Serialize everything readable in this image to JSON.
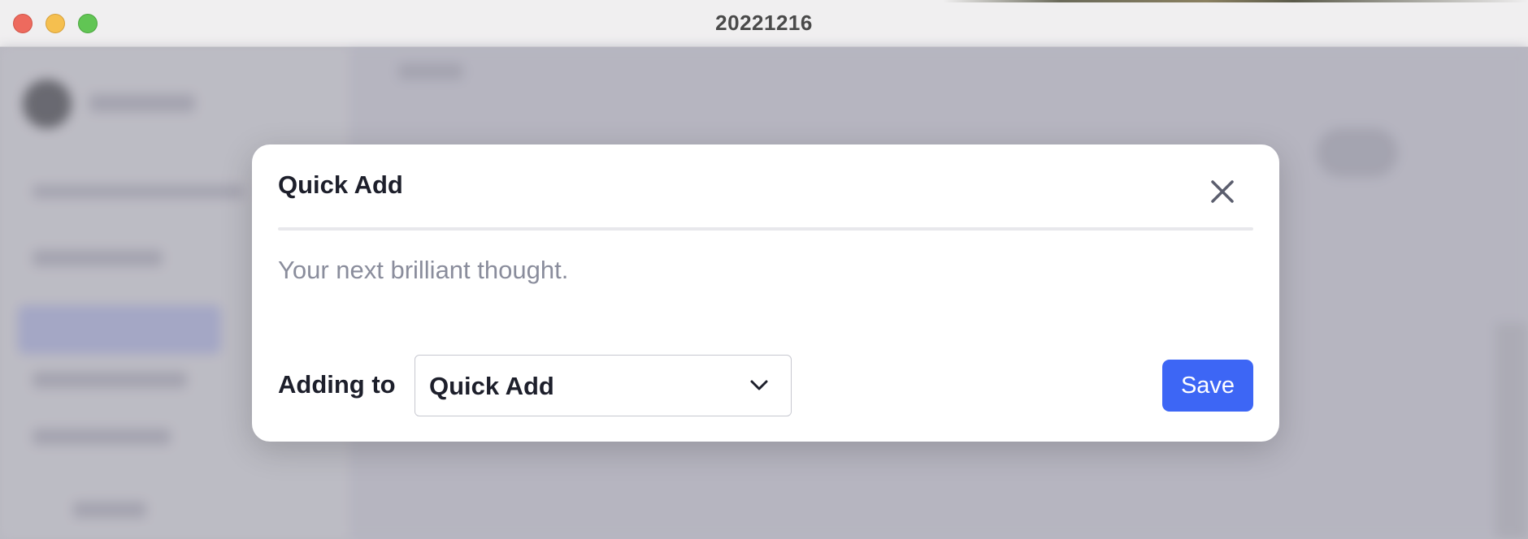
{
  "window": {
    "title": "20221216"
  },
  "modal": {
    "title": "Quick Add",
    "input_placeholder": "Your next brilliant thought.",
    "input_value": "",
    "adding_to_label": "Adding to",
    "selected_destination": "Quick Add",
    "save_label": "Save"
  },
  "icons": {
    "close": "close-icon",
    "dropdown": "chevron-down-icon"
  },
  "colors": {
    "accent": "#3d66f5",
    "text": "#1d1f2b",
    "placeholder": "#8a8d9c"
  }
}
